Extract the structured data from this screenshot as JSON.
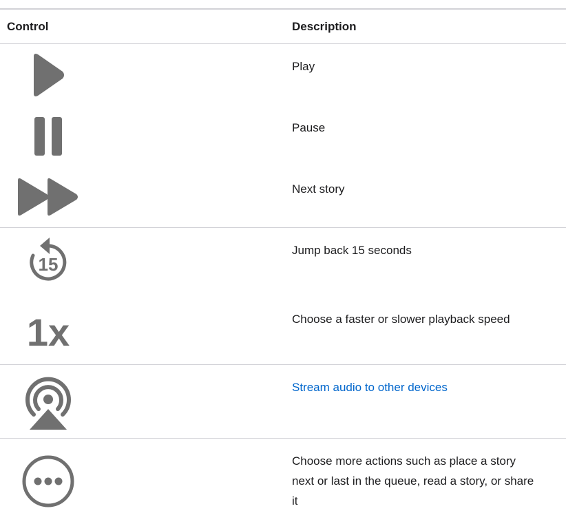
{
  "table": {
    "header": {
      "control": "Control",
      "description": "Description"
    },
    "rows": [
      {
        "icon": "play-icon",
        "description": "Play"
      },
      {
        "icon": "pause-icon",
        "description": "Pause"
      },
      {
        "icon": "next-story-icon",
        "description": "Next story"
      },
      {
        "icon": "jump-back-15-icon",
        "icon_text": "15",
        "description": "Jump back 15 seconds"
      },
      {
        "icon": "playback-speed-icon",
        "icon_text": "1x",
        "description": "Choose a faster or slower playback speed"
      },
      {
        "icon": "airplay-audio-icon",
        "description": "Stream audio to other devices",
        "is_link": true
      },
      {
        "icon": "more-actions-icon",
        "description": "Choose more actions such as place a story next or last in the queue, read a story, or share it"
      }
    ]
  },
  "colors": {
    "icon_gray": "#707070",
    "link_blue": "#0066cc",
    "divider": "#d2d2d7",
    "text": "#1d1d1f"
  }
}
